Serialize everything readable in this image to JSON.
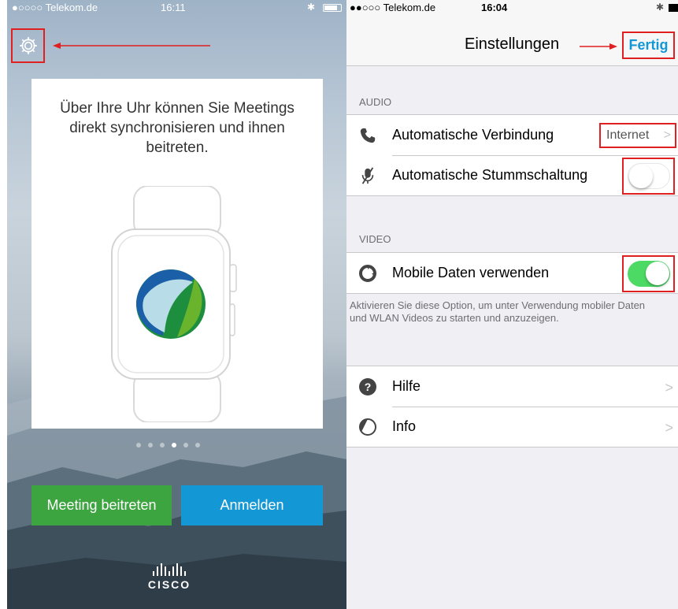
{
  "left": {
    "status": {
      "carrier": "●○○○○ Telekom.de",
      "time": "16:11"
    },
    "card_text": "Über Ihre Uhr können Sie Meetings direkt synchronisieren und ihnen beitreten.",
    "page_dots": {
      "count": 6,
      "active_index": 3
    },
    "buttons": {
      "join": "Meeting beitreten",
      "login": "Anmelden"
    },
    "brand": "CISCO",
    "colors": {
      "join": "#3da540",
      "login": "#1498d5"
    }
  },
  "right": {
    "status": {
      "carrier": "●●○○○ Telekom.de",
      "time": "16:04"
    },
    "nav": {
      "title": "Einstellungen",
      "done": "Fertig"
    },
    "audio": {
      "header": "AUDIO",
      "auto_connect": {
        "label": "Automatische Verbindung",
        "value": "Internet"
      },
      "auto_mute": {
        "label": "Automatische Stummschaltung",
        "on": false
      }
    },
    "video": {
      "header": "VIDEO",
      "mobile_data": {
        "label": "Mobile Daten verwenden",
        "on": true
      },
      "footnote": "Aktivieren Sie diese Option, um unter Verwendung mobiler Daten und WLAN Videos zu starten und anzuzeigen."
    },
    "more": {
      "help": "Hilfe",
      "info": "Info"
    },
    "colors": {
      "accent": "#1498d5",
      "toggle_on": "#4cd964",
      "highlight": "#e02020"
    }
  }
}
